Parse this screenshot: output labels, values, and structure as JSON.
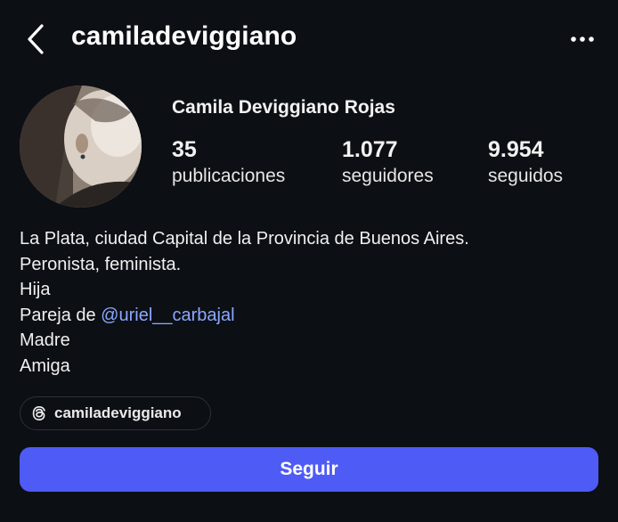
{
  "header": {
    "username": "camiladeviggiano",
    "back_icon": "chevron-left-icon",
    "more_icon": "more-horizontal-icon"
  },
  "profile": {
    "full_name": "Camila Deviggiano Rojas",
    "stats": {
      "posts": {
        "value": "35",
        "label": "publicaciones"
      },
      "followers": {
        "value": "1.077",
        "label": "seguidores"
      },
      "following": {
        "value": "9.954",
        "label": "seguidos"
      }
    }
  },
  "bio": {
    "line1": "La Plata, ciudad Capital de la Provincia de Buenos Aires.",
    "line2": "Peronista, feminista.",
    "line3": "Hija",
    "line4_prefix": "Pareja de ",
    "line4_mention": "@uriel__carbajal",
    "line5": "Madre",
    "line6": "Amiga"
  },
  "threads_link": {
    "icon": "threads-icon",
    "handle": "camiladeviggiano"
  },
  "actions": {
    "follow_label": "Seguir"
  },
  "colors": {
    "background": "#0c0f14",
    "accent": "#4f5bf5",
    "mention": "#8aa8ff"
  }
}
